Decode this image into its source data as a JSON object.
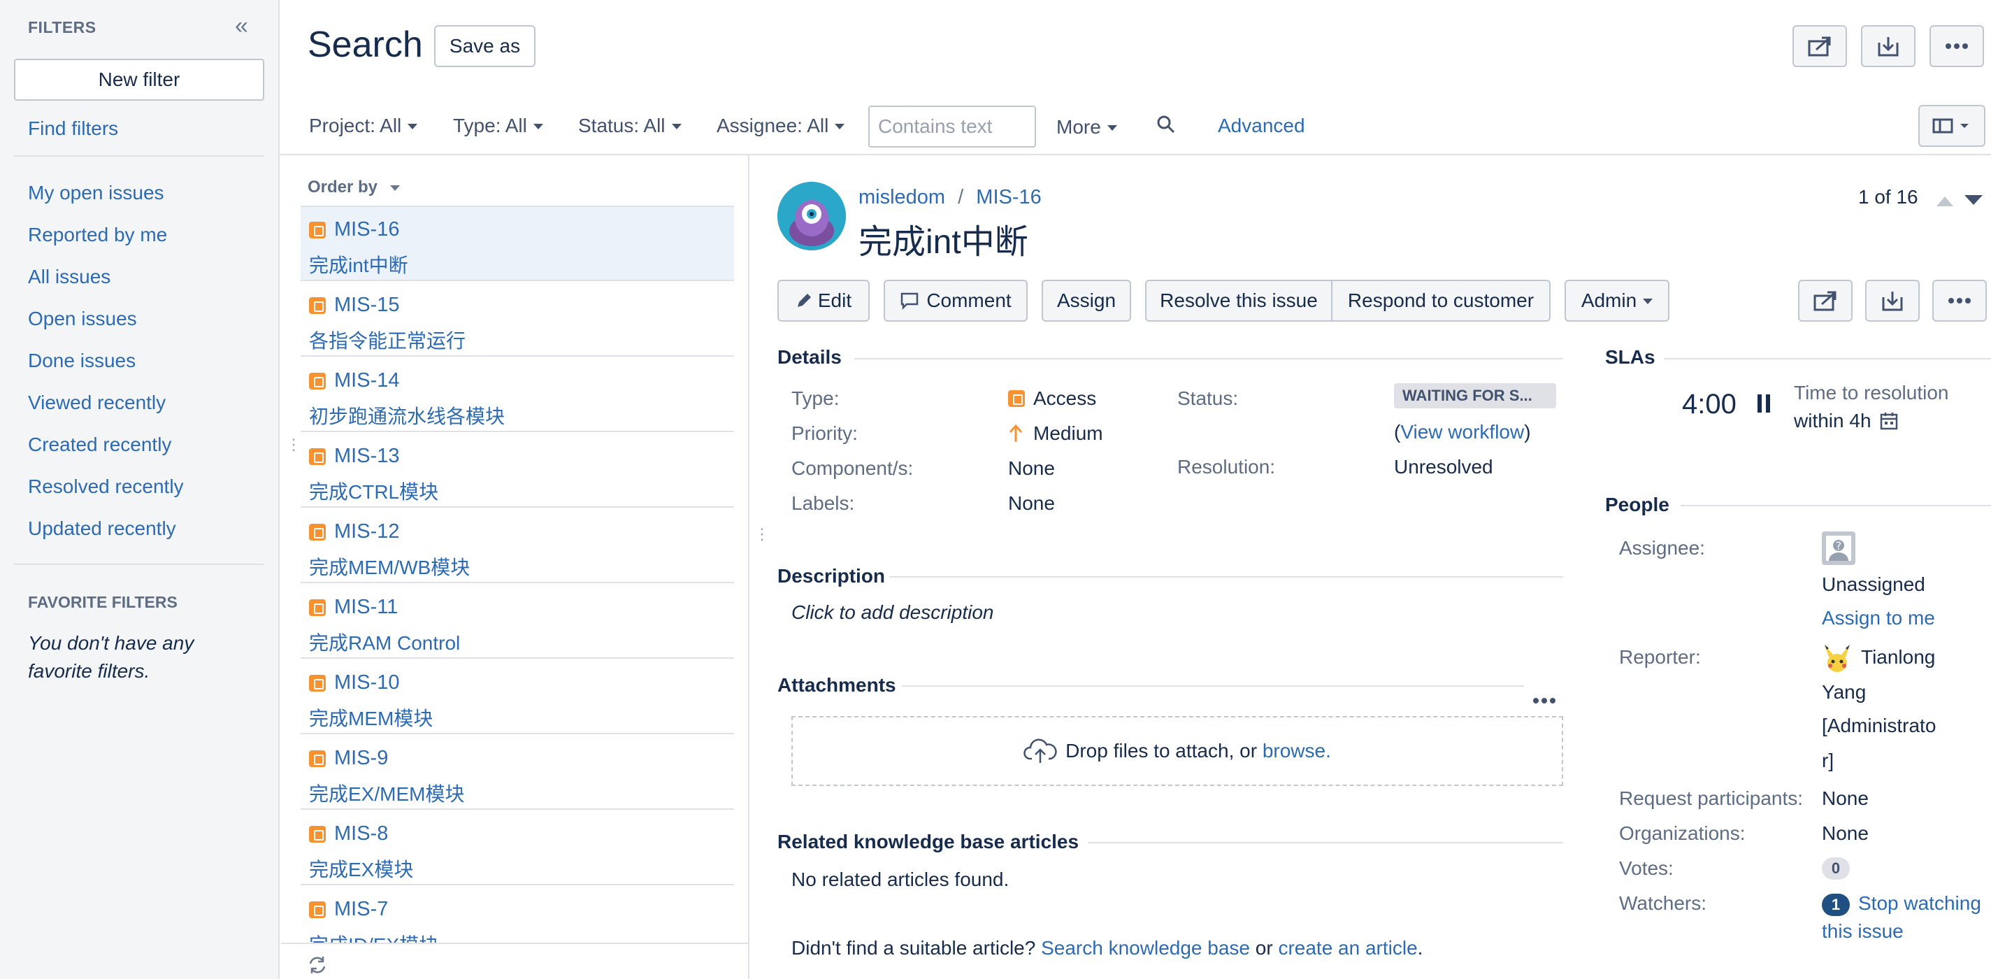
{
  "sidebar": {
    "header": "FILTERS",
    "new_filter": "New filter",
    "find_filters": "Find filters",
    "items": [
      {
        "label": "My open issues"
      },
      {
        "label": "Reported by me"
      },
      {
        "label": "All issues"
      },
      {
        "label": "Open issues"
      },
      {
        "label": "Done issues"
      },
      {
        "label": "Viewed recently"
      },
      {
        "label": "Created recently"
      },
      {
        "label": "Resolved recently"
      },
      {
        "label": "Updated recently"
      }
    ],
    "favorite_header": "FAVORITE FILTERS",
    "favorite_empty": "You don't have any favorite filters."
  },
  "header": {
    "title": "Search",
    "save_as": "Save as"
  },
  "filters": {
    "project": "Project: All",
    "type": "Type: All",
    "status": "Status: All",
    "assignee": "Assignee: All",
    "search_placeholder": "Contains text",
    "more": "More",
    "advanced": "Advanced"
  },
  "list": {
    "order_by": "Order by",
    "issues": [
      {
        "key": "MIS-16",
        "summary": "完成int中断",
        "selected": true
      },
      {
        "key": "MIS-15",
        "summary": "各指令能正常运行"
      },
      {
        "key": "MIS-14",
        "summary": "初步跑通流水线各模块"
      },
      {
        "key": "MIS-13",
        "summary": "完成CTRL模块"
      },
      {
        "key": "MIS-12",
        "summary": "完成MEM/WB模块"
      },
      {
        "key": "MIS-11",
        "summary": "完成RAM Control"
      },
      {
        "key": "MIS-10",
        "summary": "完成MEM模块"
      },
      {
        "key": "MIS-9",
        "summary": "完成EX/MEM模块"
      },
      {
        "key": "MIS-8",
        "summary": "完成EX模块"
      },
      {
        "key": "MIS-7",
        "summary": "完成ID/EX模块"
      }
    ]
  },
  "issue": {
    "project": "misledom",
    "separator": "/",
    "key": "MIS-16",
    "title": "完成int中断",
    "pager": "1 of 16",
    "actions": {
      "edit": "Edit",
      "comment": "Comment",
      "assign": "Assign",
      "resolve": "Resolve this issue",
      "respond": "Respond to customer",
      "admin": "Admin"
    },
    "details": {
      "heading": "Details",
      "type_label": "Type:",
      "type_value": "Access",
      "priority_label": "Priority:",
      "priority_value": "Medium",
      "components_label": "Component/s:",
      "components_value": "None",
      "labels_label": "Labels:",
      "labels_value": "None",
      "status_label": "Status:",
      "status_value": "WAITING FOR S...",
      "view_workflow_open": "(",
      "view_workflow": "View workflow",
      "view_workflow_close": ")",
      "resolution_label": "Resolution:",
      "resolution_value": "Unresolved"
    },
    "description": {
      "heading": "Description",
      "placeholder": "Click to add description"
    },
    "attachments": {
      "heading": "Attachments",
      "drop_text": "Drop files to attach, or",
      "browse": "browse."
    },
    "kb": {
      "heading": "Related knowledge base articles",
      "none": "No related articles found.",
      "prompt": "Didn't find a suitable article?",
      "search_link": "Search knowledge base",
      "or": "or",
      "create_link": "create an article",
      "period": "."
    }
  },
  "slas": {
    "heading": "SLAs",
    "time": "4:00",
    "target": "Time to resolution",
    "within": "within 4h"
  },
  "people": {
    "heading": "People",
    "assignee_label": "Assignee:",
    "assignee_value": "Unassigned",
    "assign_to_me": "Assign to me",
    "reporter_label": "Reporter:",
    "reporter_lines": [
      "Tianlong",
      "Yang",
      "[Administrato",
      "r]"
    ],
    "participants_label": "Request participants:",
    "participants_value": "None",
    "organizations_label": "Organizations:",
    "organizations_value": "None",
    "votes_label": "Votes:",
    "votes_count": "0",
    "watchers_label": "Watchers:",
    "watchers_count": "1",
    "stop_watching_1": "Stop watching",
    "stop_watching_2": "this issue"
  },
  "colors": {
    "link": "#2c6bb4",
    "selected_row": "#ebf2fa",
    "issue_type": "#f79232",
    "priority": "#f79232",
    "avatar_bg": "#2aa7c9"
  }
}
